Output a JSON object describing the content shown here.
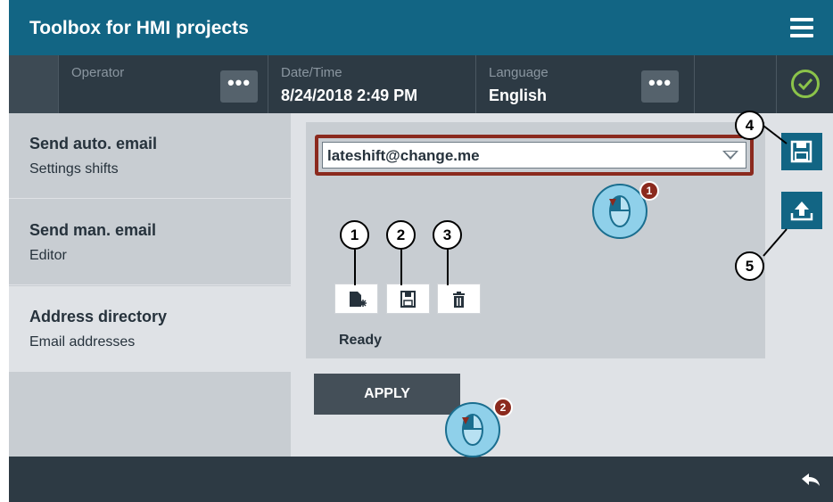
{
  "header": {
    "title": "Toolbox for HMI projects"
  },
  "status": {
    "operator_label": "Operator",
    "datetime_label": "Date/Time",
    "datetime_value": "8/24/2018 2:49 PM",
    "language_label": "Language",
    "language_value": "English",
    "dots": "•••"
  },
  "nav": [
    {
      "title": "Send auto. email",
      "subtitle": "Settings shifts"
    },
    {
      "title": "Send man. email",
      "subtitle": "Editor"
    },
    {
      "title": "Address directory",
      "subtitle": "Email addresses"
    }
  ],
  "main": {
    "combo_value": "lateshift@change.me",
    "status_text": "Ready",
    "apply_label": "APPLY"
  },
  "callouts": [
    "1",
    "2",
    "3",
    "4",
    "5"
  ],
  "step_badges": [
    "1",
    "2"
  ],
  "icons": [
    "hamburger-icon",
    "check-circle-icon",
    "new-file-icon",
    "save-icon",
    "trash-icon",
    "upload-icon",
    "back-arrow-icon",
    "mouse-icon"
  ],
  "colors": {
    "header": "#126584",
    "statusbar": "#2d3a44",
    "highlight": "#8b2a1e",
    "ok": "#8bc34a"
  }
}
